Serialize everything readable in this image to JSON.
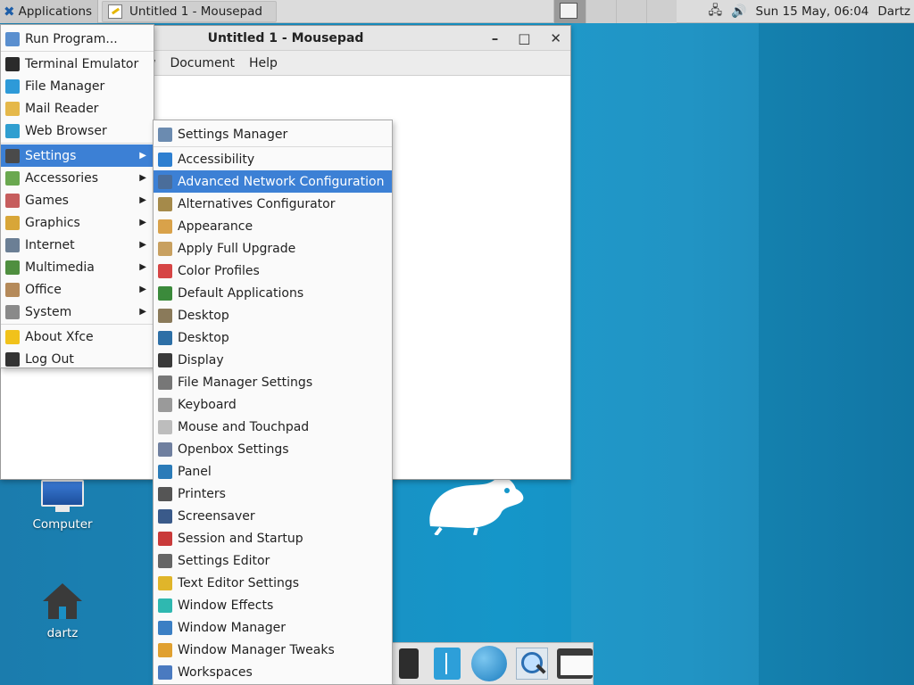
{
  "top_panel": {
    "apps_label": "Applications",
    "task_title": "Untitled 1 - Mousepad",
    "clock": "Sun 15 May, 06:04",
    "user": "Dartz"
  },
  "mousepad": {
    "title": "Untitled 1 - Mousepad",
    "menus": [
      "w",
      "Document",
      "Help"
    ]
  },
  "desktop": {
    "computer_label": "Computer",
    "home_label": "dartz"
  },
  "main_menu": {
    "items": [
      {
        "label": "Run Program...",
        "icon": "run-icon",
        "color": "#5a8fcf"
      },
      {
        "label": "Terminal Emulator",
        "icon": "terminal-icon",
        "color": "#2b2b2b"
      },
      {
        "label": "File Manager",
        "icon": "file-manager-icon",
        "color": "#2e9ad8"
      },
      {
        "label": "Mail Reader",
        "icon": "mail-icon",
        "color": "#e5b84a"
      },
      {
        "label": "Web Browser",
        "icon": "web-icon",
        "color": "#2f9ed0"
      },
      {
        "label": "Settings",
        "icon": "settings-icon",
        "color": "#4a4a4a",
        "submenu": true,
        "selected": true
      },
      {
        "label": "Accessories",
        "icon": "accessories-icon",
        "color": "#6aa84f",
        "submenu": true
      },
      {
        "label": "Games",
        "icon": "games-icon",
        "color": "#c65d5d",
        "submenu": true
      },
      {
        "label": "Graphics",
        "icon": "graphics-icon",
        "color": "#d8a638",
        "submenu": true
      },
      {
        "label": "Internet",
        "icon": "internet-icon",
        "color": "#6b7f95",
        "submenu": true
      },
      {
        "label": "Multimedia",
        "icon": "multimedia-icon",
        "color": "#4f8f3f",
        "submenu": true
      },
      {
        "label": "Office",
        "icon": "office-icon",
        "color": "#b58a5a",
        "submenu": true
      },
      {
        "label": "System",
        "icon": "system-icon",
        "color": "#8a8a8a",
        "submenu": true
      },
      {
        "label": "About Xfce",
        "icon": "star-icon",
        "color": "#f1c21b"
      },
      {
        "label": "Log Out",
        "icon": "logout-icon",
        "color": "#333333"
      }
    ]
  },
  "settings_menu": {
    "items": [
      {
        "label": "Settings Manager",
        "icon": "settings-manager-icon",
        "color": "#6b8bb0"
      },
      {
        "label": "Accessibility",
        "icon": "accessibility-icon",
        "color": "#2d7fd0"
      },
      {
        "label": "Advanced Network Configuration",
        "icon": "network-config-icon",
        "color": "#4a6d9a",
        "selected": true
      },
      {
        "label": "Alternatives Configurator",
        "icon": "alternatives-icon",
        "color": "#a58a4a"
      },
      {
        "label": "Appearance",
        "icon": "appearance-icon",
        "color": "#d9a24a"
      },
      {
        "label": "Apply Full Upgrade",
        "icon": "upgrade-icon",
        "color": "#c8a060"
      },
      {
        "label": "Color Profiles",
        "icon": "color-profiles-icon",
        "color": "#d64545"
      },
      {
        "label": "Default Applications",
        "icon": "default-apps-icon",
        "color": "#3b8a3b"
      },
      {
        "label": "Desktop",
        "icon": "desktop-icon",
        "color": "#8a7a5a"
      },
      {
        "label": "Desktop",
        "icon": "desktop-bg-icon",
        "color": "#2d6fa6"
      },
      {
        "label": "Display",
        "icon": "display-icon",
        "color": "#3a3a3a"
      },
      {
        "label": "File Manager Settings",
        "icon": "fm-settings-icon",
        "color": "#777777"
      },
      {
        "label": "Keyboard",
        "icon": "keyboard-icon",
        "color": "#9a9a9a"
      },
      {
        "label": "Mouse and Touchpad",
        "icon": "mouse-icon",
        "color": "#bdbdbd"
      },
      {
        "label": "Openbox Settings",
        "icon": "openbox-icon",
        "color": "#6f7f9f"
      },
      {
        "label": "Panel",
        "icon": "panel-icon",
        "color": "#2b7bb8"
      },
      {
        "label": "Printers",
        "icon": "printer-icon",
        "color": "#555555"
      },
      {
        "label": "Screensaver",
        "icon": "screensaver-icon",
        "color": "#3a5a8a"
      },
      {
        "label": "Session and Startup",
        "icon": "session-icon",
        "color": "#c93a3a"
      },
      {
        "label": "Settings Editor",
        "icon": "settings-editor-icon",
        "color": "#666666"
      },
      {
        "label": "Text Editor Settings",
        "icon": "text-editor-icon",
        "color": "#e0b52a"
      },
      {
        "label": "Window Effects",
        "icon": "window-effects-icon",
        "color": "#2fb8b0"
      },
      {
        "label": "Window Manager",
        "icon": "window-manager-icon",
        "color": "#3b7fc4"
      },
      {
        "label": "Window Manager Tweaks",
        "icon": "wm-tweaks-icon",
        "color": "#e0a030"
      },
      {
        "label": "Workspaces",
        "icon": "workspaces-icon",
        "color": "#4a7ac0"
      }
    ]
  },
  "colors": {
    "selection": "#3c80d5",
    "desktop_blue": "#1596c9"
  }
}
